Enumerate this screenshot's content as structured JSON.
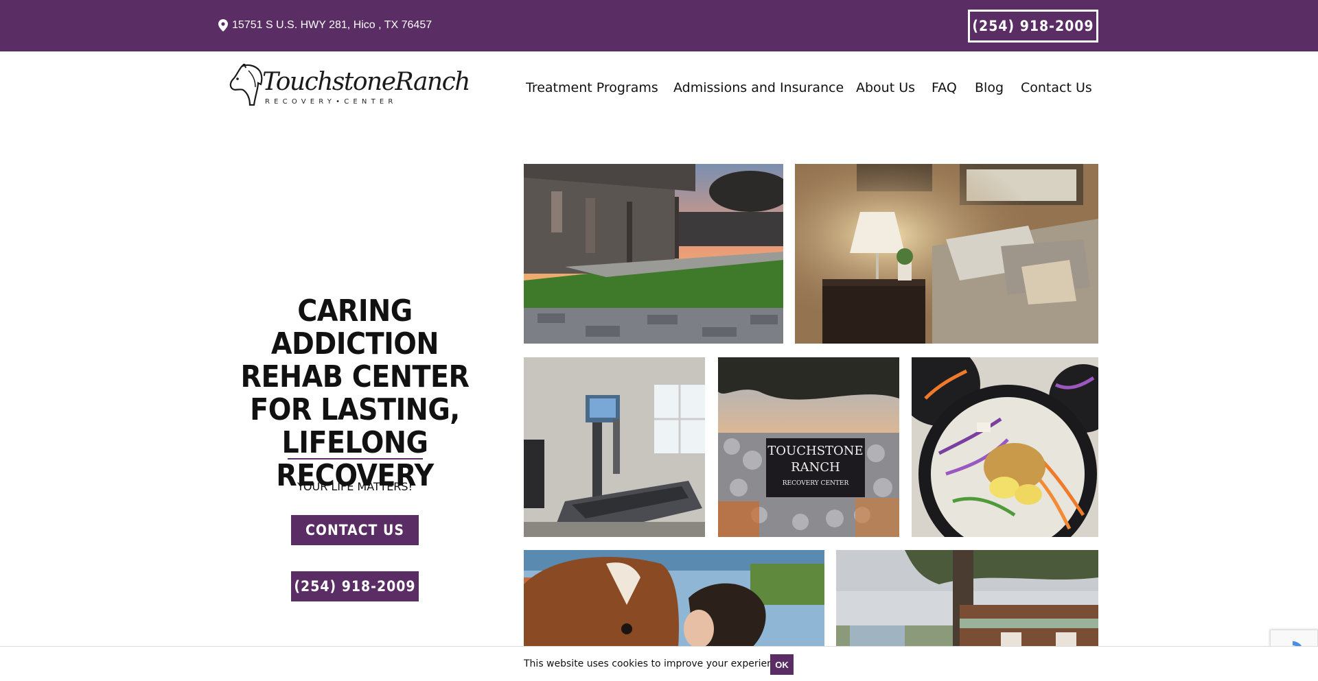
{
  "topbar": {
    "address": "15751 S U.S. HWY 281, Hico , TX 76457",
    "phone": "(254) 918-2009",
    "bg_color": "#5a2d64"
  },
  "logo": {
    "name": "TouchstoneRanch",
    "subtitle": "RECOVERY•CENTER"
  },
  "nav": {
    "items": [
      "Treatment Programs",
      "Admissions and Insurance",
      "About Us",
      "FAQ",
      "Blog",
      "Contact Us"
    ]
  },
  "hero": {
    "title": "CARING ADDICTION REHAB CENTER FOR LASTING, LIFELONG RECOVERY",
    "tagline": "YOUR LIFE MATTERS!",
    "contact_button": "CONTACT US",
    "phone_button": "(254) 918-2009"
  },
  "gallery": {
    "sign_text_line1": "TOUCHSTONE",
    "sign_text_line2": "RANCH",
    "sign_text_line3": "RECOVERY CENTER",
    "photos": [
      "porch-sunset",
      "bedroom-lamp",
      "treadmill-gym",
      "ranch-sign",
      "salad-bowl",
      "horse-and-woman",
      "barn-and-tree"
    ]
  },
  "cookie": {
    "message": "This website uses cookies to improve your experience.",
    "ok_label": "OK"
  },
  "colors": {
    "accent": "#5a2d64"
  }
}
